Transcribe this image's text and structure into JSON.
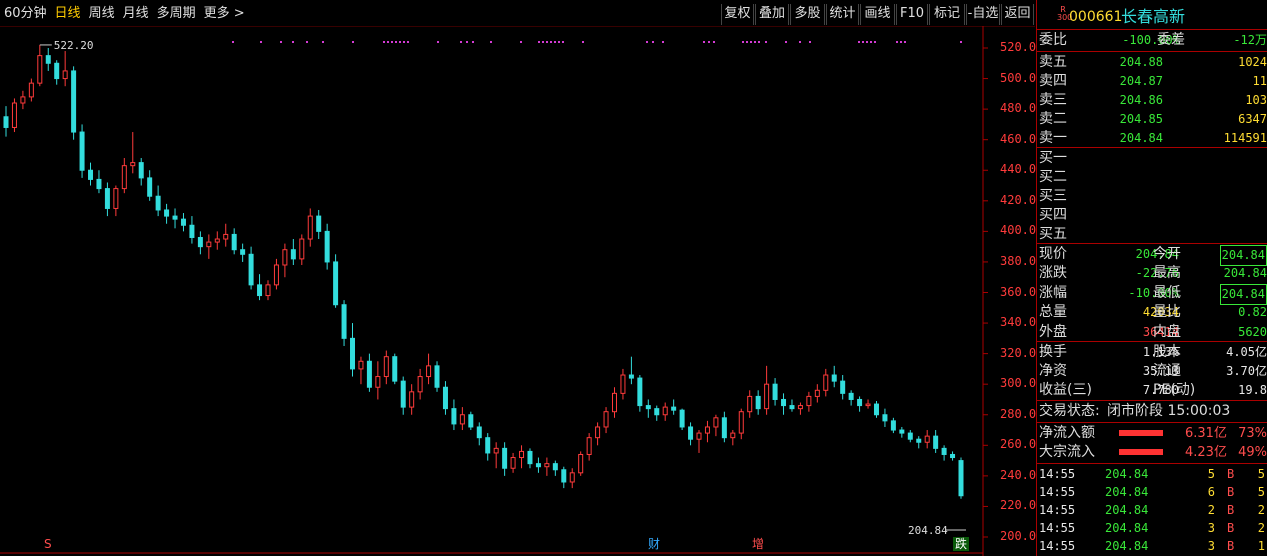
{
  "toolbar": {
    "tabs": [
      "60分钟",
      "日线",
      "周线",
      "月线",
      "多周期",
      "更多 >"
    ],
    "active": "日线",
    "buttons": [
      "复权",
      "叠加",
      "多股",
      "统计",
      "画线",
      "F10",
      "标记",
      "-自选",
      "返回"
    ]
  },
  "stock": {
    "code": "000661",
    "name": "长春高新",
    "badge_top": "R",
    "badge_bottom": "300"
  },
  "order": {
    "weibi_label": "委比",
    "weibi": "-100.00%",
    "weicha_label": "委差",
    "weicha": "-12万",
    "asks": [
      {
        "label": "卖五",
        "price": "204.88",
        "vol": "1024"
      },
      {
        "label": "卖四",
        "price": "204.87",
        "vol": "11"
      },
      {
        "label": "卖三",
        "price": "204.86",
        "vol": "103"
      },
      {
        "label": "卖二",
        "price": "204.85",
        "vol": "6347"
      },
      {
        "label": "卖一",
        "price": "204.84",
        "vol": "114591"
      }
    ],
    "bids": [
      "买一",
      "买二",
      "买三",
      "买四",
      "买五"
    ]
  },
  "quote": [
    {
      "l1": "现价",
      "v1": "204.84",
      "l2": "今开",
      "v2": "204.84",
      "c1": "green",
      "c2": "green",
      "b2": true
    },
    {
      "l1": "涨跌",
      "v1": "-22.76",
      "l2": "最高",
      "v2": "204.84",
      "c1": "green",
      "c2": "green"
    },
    {
      "l1": "涨幅",
      "v1": "-10.00%",
      "l2": "最低",
      "v2": "204.84",
      "c1": "green",
      "c2": "green",
      "b2": true
    },
    {
      "l1": "总量",
      "v1": "42034",
      "l2": "量比",
      "v2": "0.82",
      "c1": "yellow",
      "c2": "green"
    },
    {
      "l1": "外盘",
      "v1": "36414",
      "l2": "内盘",
      "v2": "5620",
      "c1": "red",
      "c2": "green"
    }
  ],
  "info": [
    {
      "l1": "换手",
      "v1": "1.13%",
      "l2": "股本",
      "v2": "4.05亿"
    },
    {
      "l1": "净资",
      "v1": "35.13",
      "l2": "流通",
      "v2": "3.70亿"
    },
    {
      "l1": "收益(三)",
      "v1": "7.780",
      "l2": "PE(动)",
      "v2": "19.8"
    }
  ],
  "status": {
    "label": "交易状态:",
    "value": "闭市阶段 15:00:03"
  },
  "flows": [
    {
      "label": "净流入额",
      "value": "6.31亿",
      "pct": "73%"
    },
    {
      "label": "大宗流入",
      "value": "4.23亿",
      "pct": "49%"
    }
  ],
  "trades": [
    {
      "time": "14:55",
      "price": "204.84",
      "vol": "5",
      "side": "B",
      "n": "5"
    },
    {
      "time": "14:55",
      "price": "204.84",
      "vol": "6",
      "side": "B",
      "n": "5"
    },
    {
      "time": "14:55",
      "price": "204.84",
      "vol": "2",
      "side": "B",
      "n": "2"
    },
    {
      "time": "14:55",
      "price": "204.84",
      "vol": "3",
      "side": "B",
      "n": "2"
    },
    {
      "time": "14:55",
      "price": "204.84",
      "vol": "3",
      "side": "B",
      "n": "1"
    }
  ],
  "chart_data": {
    "type": "candlestick",
    "y_ticks": [
      520,
      500,
      480,
      460,
      440,
      420,
      400,
      380,
      360,
      340,
      320,
      300,
      280,
      260,
      240,
      220,
      200
    ],
    "ymin": 200,
    "ymax": 520,
    "high_label": "522.20",
    "last_label": "204.84",
    "bottom_marks": [
      {
        "text": "S",
        "color": "#ff4d4d"
      },
      {
        "text": "财",
        "color": "#33aaff"
      },
      {
        "text": "增",
        "color": "#ff4d4d"
      },
      {
        "text": "跌",
        "color": "#39e839"
      }
    ],
    "colors": {
      "up": "#ff3b3b",
      "down": "#33dddd",
      "grid": "#700000",
      "dots": "#d33bd3"
    },
    "candles": [
      [
        475,
        482,
        462,
        468
      ],
      [
        468,
        487,
        465,
        484
      ],
      [
        484,
        492,
        480,
        488
      ],
      [
        488,
        500,
        485,
        497
      ],
      [
        497,
        522,
        495,
        515
      ],
      [
        515,
        520,
        505,
        510
      ],
      [
        510,
        512,
        496,
        500
      ],
      [
        500,
        518,
        495,
        505
      ],
      [
        505,
        508,
        460,
        465
      ],
      [
        465,
        470,
        435,
        440
      ],
      [
        440,
        445,
        430,
        434
      ],
      [
        434,
        440,
        425,
        428
      ],
      [
        428,
        432,
        410,
        415
      ],
      [
        415,
        430,
        410,
        428
      ],
      [
        428,
        448,
        425,
        443
      ],
      [
        443,
        465,
        438,
        445
      ],
      [
        445,
        448,
        430,
        435
      ],
      [
        435,
        440,
        420,
        423
      ],
      [
        423,
        430,
        410,
        414
      ],
      [
        414,
        418,
        405,
        410
      ],
      [
        410,
        415,
        402,
        408
      ],
      [
        408,
        412,
        400,
        404
      ],
      [
        404,
        410,
        392,
        396
      ],
      [
        396,
        400,
        385,
        390
      ],
      [
        390,
        398,
        382,
        393
      ],
      [
        393,
        400,
        388,
        395
      ],
      [
        395,
        405,
        390,
        398
      ],
      [
        398,
        402,
        385,
        388
      ],
      [
        388,
        392,
        380,
        385
      ],
      [
        385,
        390,
        362,
        365
      ],
      [
        365,
        372,
        355,
        358
      ],
      [
        358,
        368,
        355,
        365
      ],
      [
        365,
        382,
        362,
        378
      ],
      [
        378,
        392,
        370,
        388
      ],
      [
        388,
        395,
        378,
        382
      ],
      [
        382,
        398,
        378,
        395
      ],
      [
        395,
        415,
        390,
        410
      ],
      [
        410,
        414,
        395,
        400
      ],
      [
        400,
        405,
        375,
        380
      ],
      [
        380,
        385,
        350,
        352
      ],
      [
        352,
        355,
        325,
        330
      ],
      [
        330,
        340,
        305,
        310
      ],
      [
        310,
        318,
        300,
        315
      ],
      [
        315,
        320,
        295,
        298
      ],
      [
        298,
        315,
        290,
        305
      ],
      [
        305,
        322,
        300,
        318
      ],
      [
        318,
        320,
        300,
        302
      ],
      [
        302,
        305,
        280,
        285
      ],
      [
        285,
        300,
        280,
        295
      ],
      [
        295,
        310,
        290,
        305
      ],
      [
        305,
        320,
        300,
        312
      ],
      [
        312,
        315,
        295,
        298
      ],
      [
        298,
        302,
        280,
        284
      ],
      [
        284,
        290,
        270,
        274
      ],
      [
        274,
        285,
        270,
        280
      ],
      [
        280,
        282,
        270,
        272
      ],
      [
        272,
        275,
        260,
        265
      ],
      [
        265,
        268,
        250,
        255
      ],
      [
        255,
        262,
        245,
        258
      ],
      [
        258,
        262,
        240,
        245
      ],
      [
        245,
        255,
        242,
        252
      ],
      [
        252,
        260,
        245,
        256
      ],
      [
        256,
        258,
        245,
        248
      ],
      [
        248,
        252,
        242,
        246
      ],
      [
        246,
        252,
        240,
        248
      ],
      [
        248,
        250,
        240,
        244
      ],
      [
        244,
        246,
        232,
        236
      ],
      [
        236,
        245,
        232,
        242
      ],
      [
        242,
        256,
        240,
        254
      ],
      [
        254,
        268,
        250,
        265
      ],
      [
        265,
        275,
        260,
        272
      ],
      [
        272,
        285,
        268,
        282
      ],
      [
        282,
        298,
        278,
        294
      ],
      [
        294,
        310,
        290,
        306
      ],
      [
        306,
        318,
        300,
        304
      ],
      [
        304,
        306,
        282,
        286
      ],
      [
        286,
        290,
        278,
        284
      ],
      [
        284,
        286,
        276,
        280
      ],
      [
        280,
        288,
        276,
        285
      ],
      [
        285,
        290,
        280,
        283
      ],
      [
        283,
        284,
        270,
        272
      ],
      [
        272,
        275,
        260,
        264
      ],
      [
        264,
        270,
        255,
        268
      ],
      [
        268,
        276,
        262,
        272
      ],
      [
        272,
        280,
        266,
        278
      ],
      [
        278,
        282,
        262,
        265
      ],
      [
        265,
        270,
        260,
        268
      ],
      [
        268,
        284,
        264,
        282
      ],
      [
        282,
        296,
        278,
        292
      ],
      [
        292,
        296,
        280,
        284
      ],
      [
        284,
        312,
        280,
        300
      ],
      [
        300,
        304,
        286,
        290
      ],
      [
        290,
        294,
        280,
        286
      ],
      [
        286,
        290,
        282,
        284
      ],
      [
        284,
        288,
        280,
        286
      ],
      [
        286,
        295,
        282,
        292
      ],
      [
        292,
        300,
        288,
        296
      ],
      [
        296,
        310,
        292,
        306
      ],
      [
        306,
        312,
        298,
        302
      ],
      [
        302,
        306,
        290,
        294
      ],
      [
        294,
        296,
        286,
        290
      ],
      [
        290,
        292,
        282,
        286
      ],
      [
        286,
        290,
        284,
        287
      ],
      [
        287,
        289,
        278,
        280
      ],
      [
        280,
        284,
        272,
        276
      ],
      [
        276,
        278,
        268,
        270
      ],
      [
        270,
        272,
        265,
        268
      ],
      [
        268,
        270,
        262,
        264
      ],
      [
        264,
        266,
        258,
        262
      ],
      [
        262,
        270,
        258,
        266
      ],
      [
        266,
        270,
        255,
        258
      ],
      [
        258,
        260,
        250,
        254
      ],
      [
        254,
        256,
        250,
        252
      ],
      [
        250,
        252,
        225,
        227
      ]
    ]
  }
}
